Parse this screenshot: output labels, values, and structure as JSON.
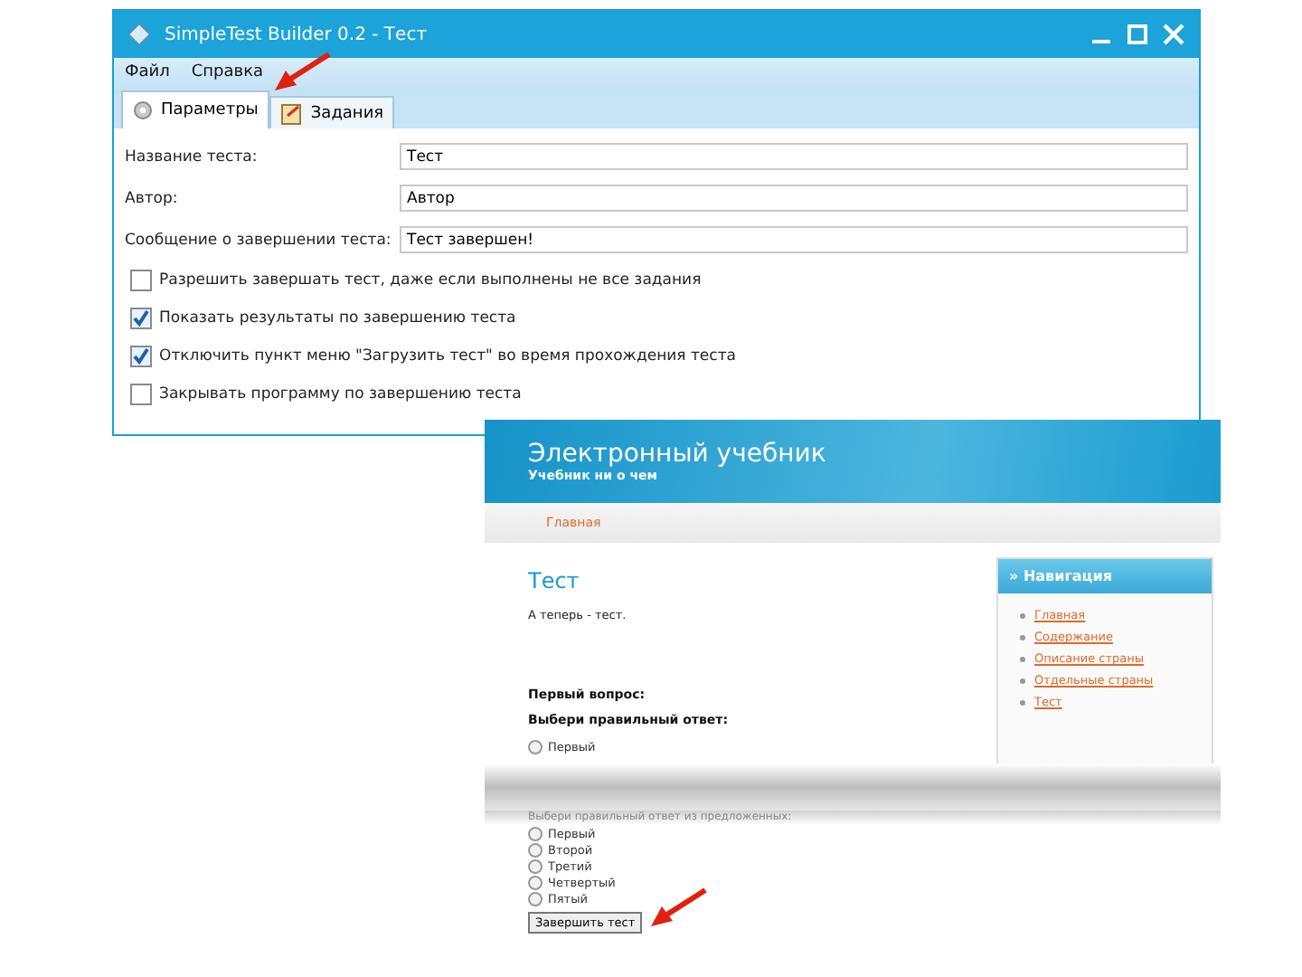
{
  "window": {
    "title": "SimpleTest Builder 0.2  - Тест",
    "menu": [
      "Файл",
      "Справка"
    ],
    "tabs": [
      {
        "label": "Параметры",
        "selected": true
      },
      {
        "label": "Задания",
        "selected": false
      }
    ],
    "fields": [
      {
        "label": "Название теста:",
        "value": "Тест"
      },
      {
        "label": "Автор:",
        "value": "Автор"
      },
      {
        "label": "Сообщение о завершении теста:",
        "value": "Тест завершен!"
      }
    ],
    "options": [
      {
        "label": "Разрешить завершать тест, даже если выполнены не все задания",
        "checked": false
      },
      {
        "label": "Показать результаты по завершению теста",
        "checked": true
      },
      {
        "label": "Отключить пункт меню \"Загрузить тест\" во время прохождения теста",
        "checked": true
      },
      {
        "label": "Закрывать программу по завершению теста",
        "checked": false
      }
    ]
  },
  "web_page": {
    "site_title": "Электронный учебник",
    "site_subtitle": "Учебник ни о чем",
    "nav": [
      "Главная"
    ],
    "heading": "Тест",
    "intro": "А теперь - тест.",
    "question": "Первый вопрос:",
    "prompt": "Выбери правильный ответ:",
    "answers_first": [
      {
        "label": "Первый",
        "selected": false
      }
    ],
    "prompt_continued": "Выбери правильный ответ из предложенных:",
    "answers": [
      {
        "label": "Первый",
        "selected": false
      },
      {
        "label": "Второй",
        "selected": false
      },
      {
        "label": "Третий",
        "selected": false
      },
      {
        "label": "Четвертый",
        "selected": false
      },
      {
        "label": "Пятый",
        "selected": false
      }
    ],
    "submit": "Завершить тест",
    "sidebar": {
      "title": "» Навигация",
      "links": [
        "Главная",
        "Содержание",
        "Описание страны",
        "Отдельные страны",
        "Тест"
      ]
    }
  }
}
